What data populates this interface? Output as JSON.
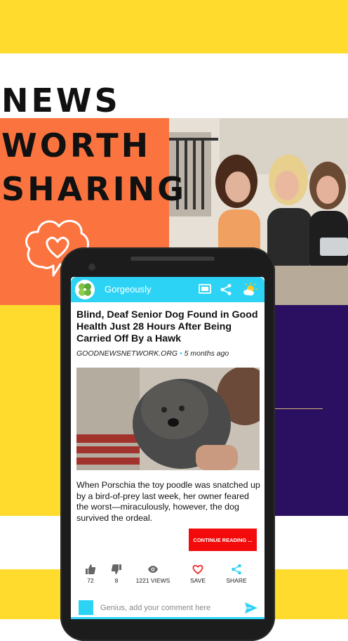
{
  "promo": {
    "headline_line1": "NEWS",
    "headline_line2": "WORTH",
    "headline_line3": "SHARING"
  },
  "colors": {
    "yellow": "#fedb2d",
    "orange": "#fb7440",
    "purple": "#2b0f60",
    "app_accent": "#2dd3f5",
    "continue_red": "#f30a0a"
  },
  "app": {
    "name": "Gorgeously",
    "icons": {
      "logo": "clover-logo-icon",
      "cast": "cast-icon",
      "share": "share-icon",
      "theme": "sun-cloud-icon"
    }
  },
  "article": {
    "title": "Blind, Deaf Senior Dog Found in Good Health Just 28 Hours After Being Carried Off By a Hawk",
    "source": "GOODNEWSNETWORK.ORG",
    "separator": "•",
    "age": "5 months ago",
    "body": "When Porschia the toy poodle was snatched up by a bird-of-prey last week, her owner feared the worst—miraculously, however, the dog survived the ordeal.",
    "continue_label": "CONTINUE READING ..."
  },
  "actions": {
    "likes": "72",
    "dislikes": "8",
    "views": "1221 VIEWS",
    "save": "SAVE",
    "share": "SHARE"
  },
  "comment": {
    "placeholder": "Genius, add your comment here"
  }
}
